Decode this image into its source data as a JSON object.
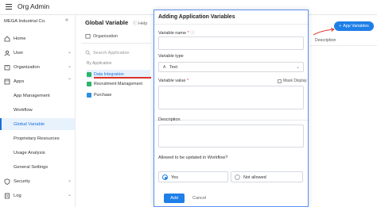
{
  "topbar": {
    "title": "Org Admin"
  },
  "sidebar": {
    "company": "MEGA Industrial Co.",
    "items": [
      {
        "label": "Home",
        "icon": "home-icon"
      },
      {
        "label": "User",
        "icon": "user-icon"
      },
      {
        "label": "Organization",
        "icon": "organization-icon"
      },
      {
        "label": "Apps",
        "icon": "apps-icon"
      },
      {
        "label": "App Management"
      },
      {
        "label": "Workflow"
      },
      {
        "label": "Global Variable"
      },
      {
        "label": "Proprietary Resources"
      },
      {
        "label": "Usage Analysis"
      },
      {
        "label": "General Settings"
      },
      {
        "label": "Security",
        "icon": "shield-icon"
      },
      {
        "label": "Log",
        "icon": "log-icon"
      }
    ]
  },
  "middle": {
    "title": "Global Variable",
    "help": "Help",
    "organization": "Organization",
    "search_placeholder": "Search Application",
    "by_application": "By Application",
    "apps": [
      {
        "label": "Data Integration",
        "color": "#2db36b"
      },
      {
        "label": "Recruitment Management",
        "color": "#2db36b"
      },
      {
        "label": "Purchase",
        "color": "#2a8fe0"
      }
    ]
  },
  "right": {
    "add_button": "App Variables",
    "description_header": "Description"
  },
  "dialog": {
    "title": "Adding Application Variables",
    "variable_name_label": "Variable name",
    "variable_type_label": "Variable type",
    "variable_type_value": "Text",
    "variable_value_label": "Variable value",
    "mask_display": "Mask Display",
    "description_label": "Description",
    "allowed_label": "Allowed to be updated in Workflow?",
    "yes": "Yes",
    "not_allowed": "Not allowed",
    "add": "Add",
    "cancel": "Cancel"
  },
  "colors": {
    "accent": "#1f7fe8",
    "required": "#d9342b"
  }
}
